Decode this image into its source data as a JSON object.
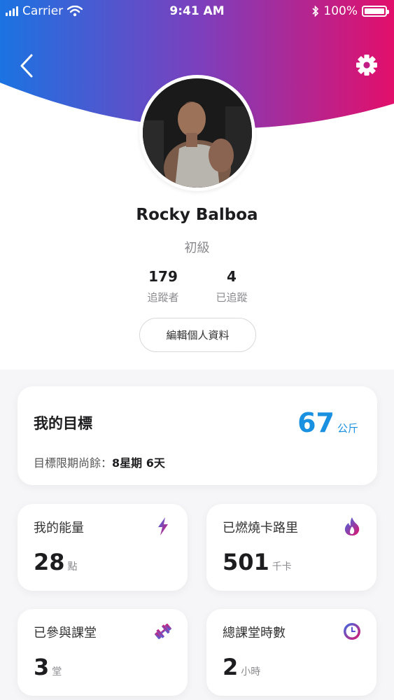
{
  "status_bar": {
    "carrier": "Carrier",
    "time": "9:41 AM",
    "battery": "100%"
  },
  "profile": {
    "name": "Rocky Balboa",
    "level": "初級",
    "followers_count": "179",
    "followers_label": "追蹤者",
    "following_count": "4",
    "following_label": "已追蹤",
    "edit_button": "編輯個人資料"
  },
  "goal": {
    "title": "我的目標",
    "value": "67",
    "unit": "公斤",
    "deadline_label": "目標限期尚餘：",
    "deadline_value": "8星期 6天"
  },
  "stats": [
    {
      "title": "我的能量",
      "value": "28",
      "unit": "點",
      "icon": "lightning-icon"
    },
    {
      "title": "已燃燒卡路里",
      "value": "501",
      "unit": "千卡",
      "icon": "flame-icon"
    },
    {
      "title": "已參與課堂",
      "value": "3",
      "unit": "堂",
      "icon": "dumbbell-icon"
    },
    {
      "title": "總課堂時數",
      "value": "2",
      "unit": "小時",
      "icon": "clock-icon"
    }
  ],
  "colors": {
    "gradient_start": "#1f6fe0",
    "gradient_mid": "#7a3fc0",
    "gradient_end": "#e0106a",
    "accent_blue": "#1a91e0"
  }
}
